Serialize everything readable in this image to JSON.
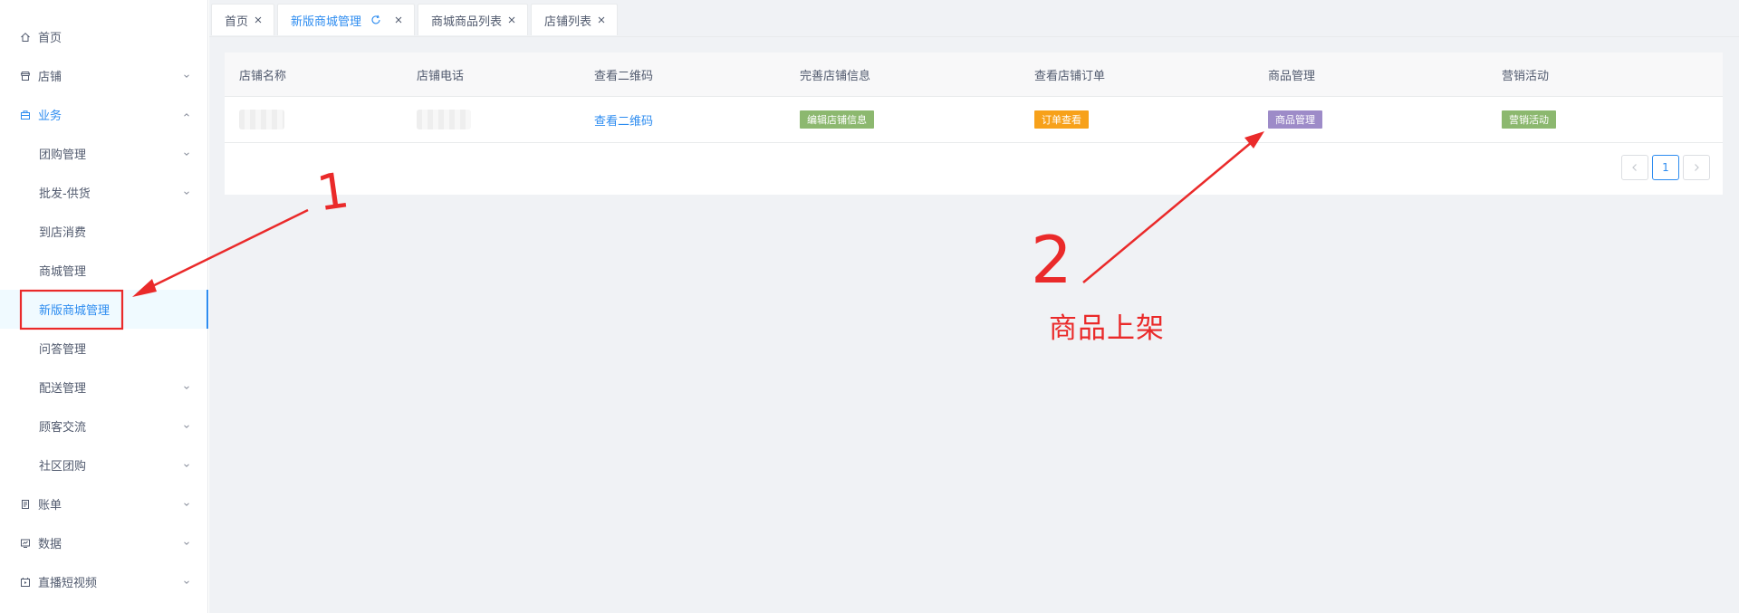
{
  "sidebar": {
    "items": [
      {
        "label": "首页",
        "icon": "home-icon",
        "level": 1,
        "arrow": "",
        "state": ""
      },
      {
        "label": "店铺",
        "icon": "store-icon",
        "level": 1,
        "arrow": "down",
        "state": ""
      },
      {
        "label": "业务",
        "icon": "briefcase-icon",
        "level": 1,
        "arrow": "up",
        "state": "open-blue"
      },
      {
        "label": "团购管理",
        "icon": "",
        "level": 2,
        "arrow": "down",
        "state": ""
      },
      {
        "label": "批发-供货",
        "icon": "",
        "level": 2,
        "arrow": "down",
        "state": ""
      },
      {
        "label": "到店消费",
        "icon": "",
        "level": 2,
        "arrow": "",
        "state": ""
      },
      {
        "label": "商城管理",
        "icon": "",
        "level": 2,
        "arrow": "",
        "state": ""
      },
      {
        "label": "新版商城管理",
        "icon": "",
        "level": 2,
        "arrow": "",
        "state": "active"
      },
      {
        "label": "问答管理",
        "icon": "",
        "level": 2,
        "arrow": "",
        "state": ""
      },
      {
        "label": "配送管理",
        "icon": "",
        "level": 2,
        "arrow": "down",
        "state": ""
      },
      {
        "label": "顾客交流",
        "icon": "",
        "level": 2,
        "arrow": "down",
        "state": ""
      },
      {
        "label": "社区团购",
        "icon": "",
        "level": 2,
        "arrow": "down",
        "state": ""
      },
      {
        "label": "账单",
        "icon": "bill-icon",
        "level": 1,
        "arrow": "down",
        "state": ""
      },
      {
        "label": "数据",
        "icon": "data-icon",
        "level": 1,
        "arrow": "down",
        "state": ""
      },
      {
        "label": "直播短视频",
        "icon": "video-icon",
        "level": 1,
        "arrow": "down",
        "state": ""
      }
    ]
  },
  "tabs": [
    {
      "label": "首页",
      "active": false,
      "refresh": false
    },
    {
      "label": "新版商城管理",
      "active": true,
      "refresh": true
    },
    {
      "label": "商城商品列表",
      "active": false,
      "refresh": false
    },
    {
      "label": "店铺列表",
      "active": false,
      "refresh": false
    }
  ],
  "table": {
    "headers": [
      "店铺名称",
      "店铺电话",
      "查看二维码",
      "完善店铺信息",
      "查看店铺订单",
      "商品管理",
      "营销活动"
    ],
    "row": {
      "qr_link": "查看二维码",
      "edit_btn": "编辑店铺信息",
      "order_btn": "订单查看",
      "goods_btn": "商品管理",
      "marketing_btn": "营销活动"
    }
  },
  "pagination": {
    "current": "1"
  },
  "annotations": {
    "label": "商品上架",
    "num1": "1",
    "num2": "2",
    "color": "#ea2a2a"
  },
  "colors": {
    "accent": "#2d8cf0",
    "edit_btn": "#8cb86f",
    "order_btn": "#f7a11a",
    "goods_btn": "#9d8bc8",
    "marketing_btn": "#8cb86f"
  }
}
